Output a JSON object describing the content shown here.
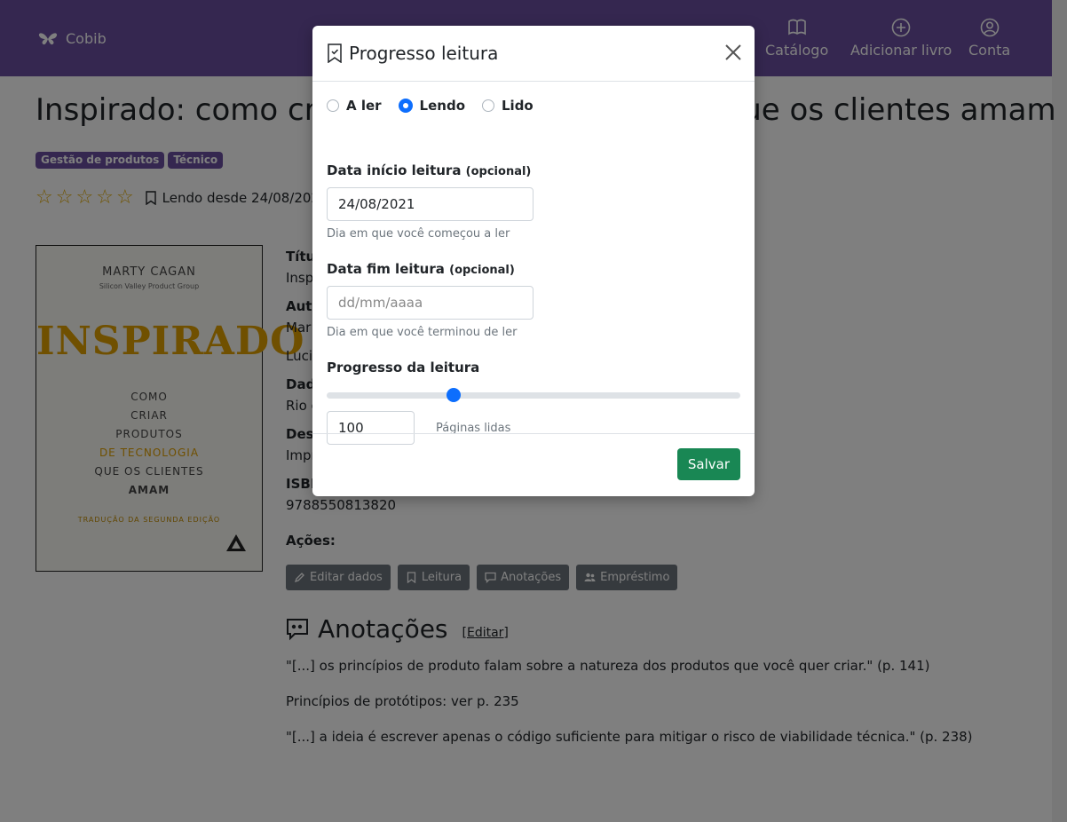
{
  "navbar": {
    "brand": "Cobib",
    "items": [
      {
        "label": "Catálogo",
        "icon": "book-icon"
      },
      {
        "label": "Adicionar livro",
        "icon": "plus-circle-icon"
      },
      {
        "label": "Conta",
        "icon": "user-circle-icon"
      }
    ]
  },
  "book": {
    "title": "Inspirado: como criar produtos de tecnologia que os clientes amam",
    "tags": [
      "Gestão de produtos",
      "Técnico"
    ],
    "rating": 0,
    "rating_max": 5,
    "reading_status": "Lendo desde 24/08/2021",
    "cover": {
      "author": "MARTY CAGAN",
      "group": "Silicon Valley Product Group",
      "title": "INSPIRADO",
      "line1": "COMO",
      "line2": "CRIAR",
      "line3": "PRODUTOS",
      "line4": "DE TECNOLOGIA",
      "line5": "QUE OS CLIENTES",
      "line6": "AMAM",
      "edition": "TRADUÇÃO DA SEGUNDA EDIÇÃO",
      "publisher": "ALTA BOOKS"
    },
    "details": [
      {
        "label": "Títu",
        "value": "Insp"
      },
      {
        "label": "Auto",
        "value": "Mar"
      },
      {
        "label": "",
        "value": "Lucia"
      },
      {
        "label": "Dad",
        "value": "Rio c"
      },
      {
        "label": "Desc",
        "value": "Impr"
      },
      {
        "label": "ISBN",
        "value": "9788550813820"
      }
    ],
    "actions_label": "Ações:",
    "actions": [
      "Editar dados",
      "Leitura",
      "Anotações",
      "Empréstimo"
    ]
  },
  "annotations": {
    "title": "Anotações",
    "edit_link": "[Editar]",
    "items": [
      "\"[...] os princípios de produto falam sobre a natureza dos produtos que você quer criar.\" (p. 141)",
      "Princípios de protótipos: ver p. 235",
      "\"[...] a ideia é escrever apenas o código suficiente para mitigar o risco de viabilidade técnica.\" (p. 238)"
    ]
  },
  "modal": {
    "title": "Progresso leitura",
    "status_options": [
      "A ler",
      "Lendo",
      "Lido"
    ],
    "selected_status": "Lendo",
    "start_date": {
      "label": "Data início leitura",
      "optional": "(opcional)",
      "value": "24/08/2021",
      "help": "Dia em que você começou a ler"
    },
    "end_date": {
      "label": "Data fim leitura",
      "optional": "(opcional)",
      "placeholder": "dd/mm/aaaa",
      "help": "Dia em que você terminou de ler"
    },
    "progress": {
      "label": "Progresso da leitura",
      "fraction": 0.3,
      "pages": "100",
      "pages_label": "Páginas lidas"
    },
    "save_label": "Salvar"
  },
  "colors": {
    "navbar": "#6a4fa0",
    "primary": "#0d6efd",
    "success": "#198754",
    "secondary": "#6c757d",
    "star": "#e0a800"
  }
}
